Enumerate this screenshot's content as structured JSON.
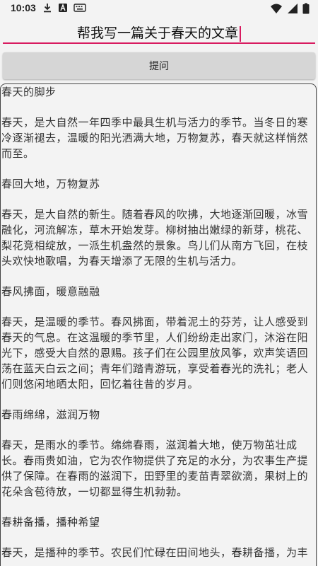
{
  "status_bar": {
    "time": "10:03",
    "left_icons": [
      "download-icon",
      "a-badge-icon",
      "keyboard-icon"
    ],
    "right_icons": [
      "wifi-icon",
      "signal-icon",
      "battery-icon"
    ]
  },
  "prompt": {
    "value": "帮我写一篇关于春天的文章"
  },
  "ask_button": {
    "label": "提问"
  },
  "answer": {
    "paragraphs": [
      "春天的脚步",
      "春天，是大自然一年四季中最具生机与活力的季节。当冬日的寒冷逐渐褪去，温暖的阳光洒满大地，万物复苏，春天就这样悄然而至。",
      "春回大地，万物复苏",
      "春天，是大自然的新生。随着春风的吹拂，大地逐渐回暖，冰雪融化，河流解冻，草木开始发芽。柳树抽出嫩绿的新芽，桃花、梨花竞相绽放，一派生机盎然的景象。鸟儿们从南方飞回，在枝头欢快地歌唱，为春天增添了无限的生机与活力。",
      "春风拂面，暖意融融",
      "春天，是温暖的季节。春风拂面，带着泥土的芬芳，让人感受到春天的气息。在这温暖的季节里，人们纷纷走出家门，沐浴在阳光下，感受大自然的恩赐。孩子们在公园里放风筝，欢声笑语回荡在蓝天白云之间；青年们踏青游玩，享受着春光的洗礼；老人们则悠闲地晒太阳，回忆着往昔的岁月。",
      "春雨绵绵，滋润万物",
      "春天，是雨水的季节。绵绵春雨，滋润着大地，使万物茁壮成长。春雨贵如油，它为农作物提供了充足的水分，为农事生产提供了保障。在春雨的滋润下，田野里的麦苗青翠欲滴，果树上的花朵含苞待放，一切都显得生机勃勃。",
      "春耕备播，播种希望",
      "春天，是播种的季节。农民们忙碌在田间地头，春耕备播，为丰"
    ]
  },
  "colors": {
    "accent": "#d81b60",
    "background": "#f3f3f3",
    "button_bg": "#d6d6d6"
  }
}
